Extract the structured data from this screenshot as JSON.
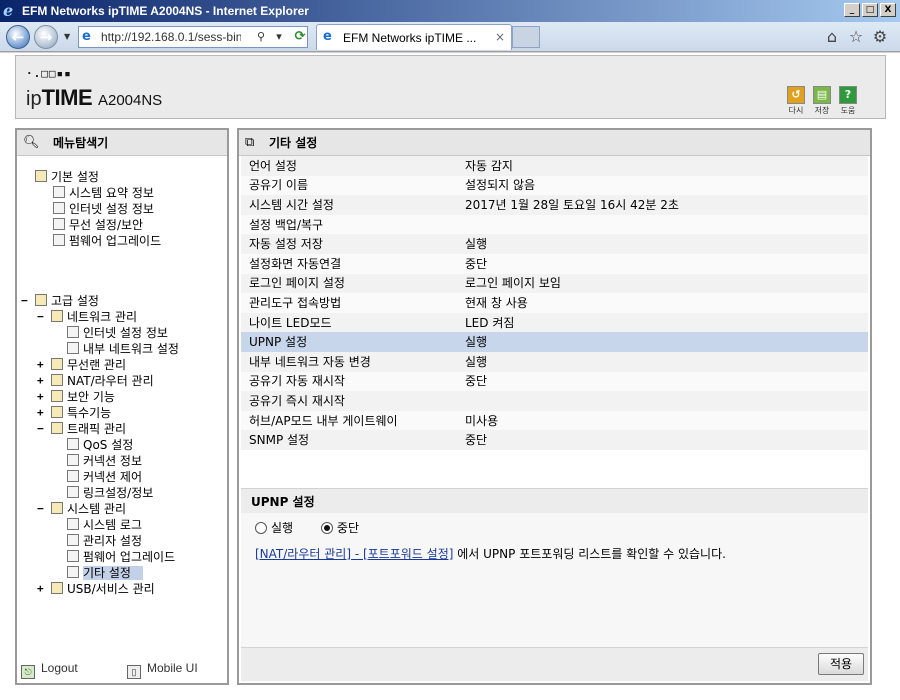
{
  "window": {
    "title": "EFM Networks ipTIME A2004NS - Internet Explorer",
    "minimize": "_",
    "maximize": "□",
    "close": "X"
  },
  "browser": {
    "address": "http://192.168.0.1/sess-bin",
    "tab_label": "EFM Networks ipTIME ...",
    "tab_close": "×"
  },
  "header": {
    "logo_dots": "·.□□▪▪",
    "logo_ip": "ip",
    "logo_time": "TIME",
    "model": "A2004NS",
    "buttons": [
      {
        "label": "다시",
        "color": "#e0a020"
      },
      {
        "label": "저장",
        "color": "#7ab648"
      },
      {
        "label": "도움",
        "color": "#2e9a3c"
      }
    ]
  },
  "left": {
    "title": "메뉴탐색기",
    "basic": {
      "label": "기본 설정",
      "items": [
        "시스템 요약 정보",
        "인터넷 설정 정보",
        "무선 설정/보안",
        "펌웨어 업그레이드"
      ]
    },
    "advanced": {
      "label": "고급 설정",
      "network": {
        "label": "네트워크 관리",
        "children": [
          "인터넷 설정 정보",
          "내부 네트워크 설정"
        ]
      },
      "wireless": "무선랜 관리",
      "nat": "NAT/라우터 관리",
      "security": "보안 기능",
      "special": "특수기능",
      "traffic": {
        "label": "트래픽 관리",
        "children": [
          "QoS 설정",
          "커넥션 정보",
          "커넥션 제어",
          "링크설정/정보"
        ]
      },
      "system": {
        "label": "시스템 관리",
        "children": [
          "시스템 로그",
          "관리자 설정",
          "펌웨어 업그레이드",
          "기타 설정"
        ]
      },
      "usb": "USB/서비스 관리"
    },
    "footer": {
      "logout": "Logout",
      "mobile": "Mobile UI"
    }
  },
  "right": {
    "title": "기타 설정",
    "rows": [
      {
        "key": "언어 설정",
        "value": "자동 감지"
      },
      {
        "key": "공유기 이름",
        "value": "설정되지 않음"
      },
      {
        "key": "시스템 시간 설정",
        "value": "2017년 1월 28일 토요일 16시 42분 2초"
      },
      {
        "key": "설정 백업/복구",
        "value": ""
      },
      {
        "key": "자동 설정 저장",
        "value": "실행"
      },
      {
        "key": "설정화면 자동연결",
        "value": "중단"
      },
      {
        "key": "로그인 페이지 설정",
        "value": "로그인 페이지 보임"
      },
      {
        "key": "관리도구 접속방법",
        "value": "현재 창 사용"
      },
      {
        "key": "나이트 LED모드",
        "value": "LED 켜짐"
      },
      {
        "key": "UPNP 설정",
        "value": "실행"
      },
      {
        "key": "내부 네트워크 자동 변경",
        "value": "실행"
      },
      {
        "key": "공유기 자동 재시작",
        "value": "중단"
      },
      {
        "key": "공유기 즉시 재시작",
        "value": ""
      },
      {
        "key": "허브/AP모드 내부 게이트웨이",
        "value": "미사용"
      },
      {
        "key": "SNMP 설정",
        "value": "중단"
      }
    ],
    "selected_row": 9,
    "sub": {
      "title": "UPNP 설정",
      "options": [
        "실행",
        "중단"
      ],
      "selected": "중단",
      "link": "[NAT/라우터 관리] - [포트포워드 설정]",
      "note": " 에서 UPNP 포트포워딩 리스트를 확인할 수 있습니다."
    },
    "apply": "적용"
  }
}
